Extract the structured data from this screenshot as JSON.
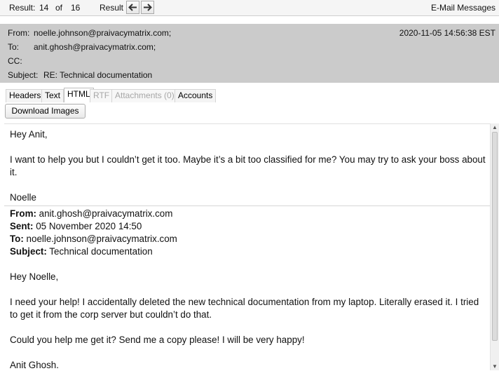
{
  "topbar": {
    "result_label": "Result:",
    "result_index": "14",
    "of_label": "of",
    "result_total": "16",
    "nav_label": "Result",
    "view_name": "E-Mail Messages"
  },
  "header": {
    "from_label": "From:",
    "from_value": "noelle.johnson@praivacymatrix.com;",
    "to_label": "To:",
    "to_value": "anit.ghosh@praivacymatrix.com;",
    "cc_label": "CC:",
    "subject_label": "Subject:",
    "subject_value": "RE: Technical documentation",
    "date": "2020-11-05 14:56:38 EST"
  },
  "tabs": [
    {
      "label": "Headers"
    },
    {
      "label": "Text"
    },
    {
      "label": "HTML"
    },
    {
      "label": "RTF"
    },
    {
      "label": "Attachments (0)"
    },
    {
      "label": "Accounts"
    }
  ],
  "download_images_label": "Download Images",
  "body": {
    "greeting": "Hey Anit,",
    "para1": "I want to help you but I couldn’t get it too. Maybe it’s a bit too classified for me? You may try to ask your boss about it.",
    "signature": "Noelle",
    "quoted": {
      "from_label": "From:",
      "from_value": " anit.ghosh@praivacymatrix.com",
      "sent_label": "Sent:",
      "sent_value": " 05 November 2020 14:50",
      "to_label": "To:",
      "to_value": " noelle.johnson@praivacymatrix.com",
      "subject_label": "Subject:",
      "subject_value": " Technical documentation",
      "greeting": "Hey Noelle,",
      "para1": "I need your help! I accidentally deleted the new technical documentation from my laptop. Literally erased it. I tried to get it from the corp server but couldn’t do that.",
      "para2": "Could you help me get it? Send me a copy please! I will be very happy!",
      "signature": "Anit Ghosh."
    }
  }
}
